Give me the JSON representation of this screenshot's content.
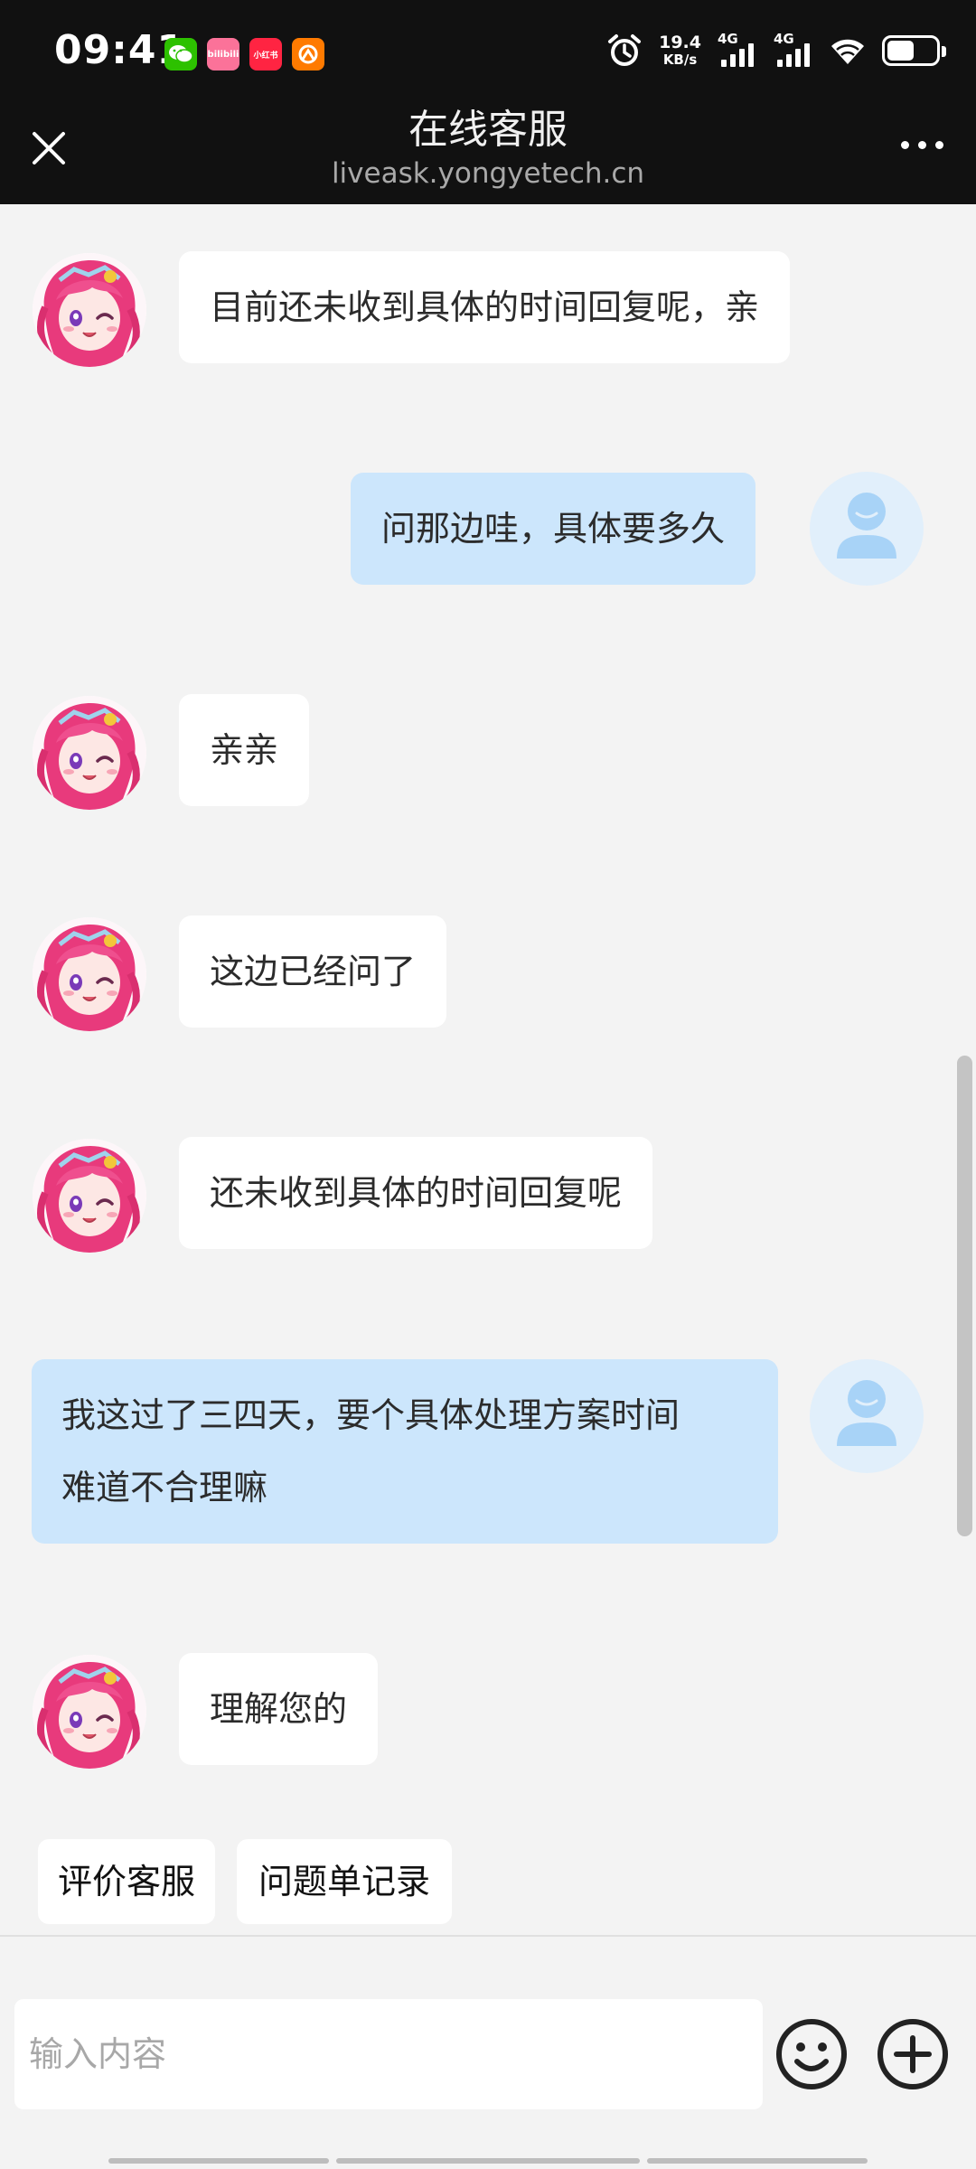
{
  "status_bar": {
    "time": "09:41",
    "net_speed_value": "19.4",
    "net_speed_unit": "KB/s",
    "sim1_type": "4G",
    "sim2_type": "4G",
    "app_icons": [
      {
        "name": "wechat-icon",
        "color": "#2dc100"
      },
      {
        "name": "bilibili-icon",
        "color": "#fb7299",
        "text": "bilibili"
      },
      {
        "name": "xiaohongshu-icon",
        "color": "#ff2442",
        "text": "小红书"
      },
      {
        "name": "app-icon",
        "color": "#ff7a00"
      }
    ],
    "battery_level": 0.55
  },
  "header": {
    "title": "在线客服",
    "url": "liveask.yongyetech.cn"
  },
  "messages": [
    {
      "from": "agent",
      "text": "目前还未收到具体的时间回复呢，亲"
    },
    {
      "from": "user",
      "text": "问那边哇，具体要多久"
    },
    {
      "from": "agent",
      "text": "亲亲"
    },
    {
      "from": "agent",
      "text": "这边已经问了"
    },
    {
      "from": "agent",
      "text": "还未收到具体的时间回复呢"
    },
    {
      "from": "user",
      "line1": "我这过了三四天，要个具体处理方案时间",
      "line2": "难道不合理嘛"
    },
    {
      "from": "agent",
      "text": "理解您的"
    }
  ],
  "quick_actions": [
    {
      "label": "评价客服"
    },
    {
      "label": "问题单记录"
    }
  ],
  "input": {
    "placeholder": "输入内容",
    "value": ""
  },
  "colors": {
    "header_bg": "#111111",
    "chat_bg": "#f3f3f3",
    "user_bubble": "#cce6fc",
    "agent_bubble": "#ffffff",
    "user_avatar": "#a8d3f7"
  }
}
